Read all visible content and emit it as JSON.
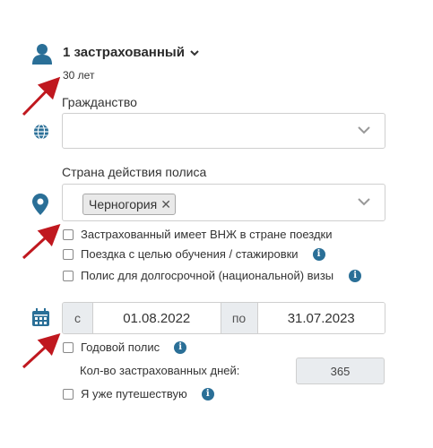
{
  "insured": {
    "title": "1 застрахованный",
    "age": "30 лет"
  },
  "citizenship": {
    "label": "Гражданство",
    "value": ""
  },
  "policy_country": {
    "label": "Страна действия полиса",
    "tags": [
      "Черногория"
    ],
    "remove_symbol": "✕"
  },
  "options": {
    "residence_permit": "Застрахованный имеет ВНЖ в стране поездки",
    "study_trip": "Поездка с целью обучения / стажировки",
    "long_term_visa": "Полис для долгосрочной (национальной) визы"
  },
  "dates": {
    "from_prefix": "с",
    "from_value": "01.08.2022",
    "to_prefix": "по",
    "to_value": "31.07.2023"
  },
  "annual_policy": "Годовой полис",
  "days": {
    "label": "Кол-во застрахованных дней:",
    "value": "365"
  },
  "already_traveling": "Я уже путешествую",
  "info_symbol": "i",
  "colors": {
    "icon": "#2a6f97",
    "arrow": "#c0181f",
    "border": "#cfcfcf",
    "addon_bg": "#e9ecef"
  }
}
